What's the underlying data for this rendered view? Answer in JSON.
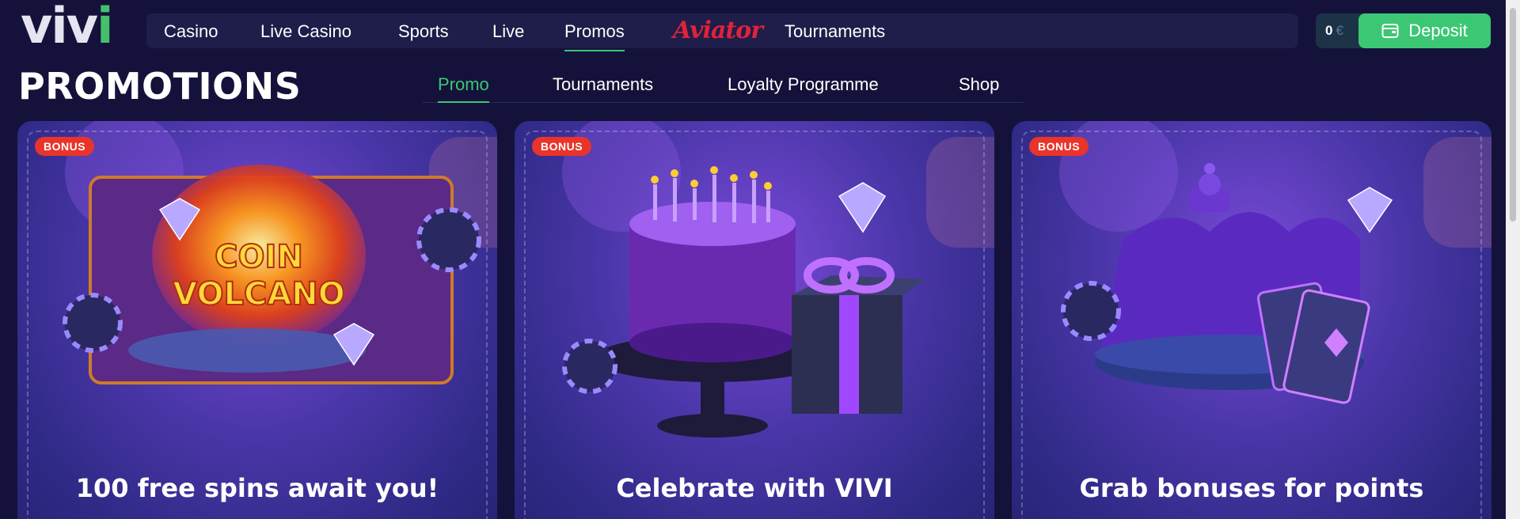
{
  "logo": {
    "left": "viv",
    "accent": "i"
  },
  "nav": {
    "items": [
      "Casino",
      "Live Casino",
      "Sports",
      "Live",
      "Promos"
    ],
    "aviator": "Aviator",
    "tournaments": "Tournaments",
    "active": "Promos"
  },
  "wallet": {
    "balance": "0",
    "currency": "€",
    "deposit_label": "Deposit"
  },
  "page": {
    "title": "PROMOTIONS"
  },
  "subtabs": [
    "Promo",
    "Tournaments",
    "Loyalty Programme",
    "Shop"
  ],
  "cards": [
    {
      "badge": "BONUS",
      "title": "100 free spins await you!",
      "art_text_1": "COIN",
      "art_text_2": "VOLCANO"
    },
    {
      "badge": "BONUS",
      "title": "Celebrate with VIVI"
    },
    {
      "badge": "BONUS",
      "title": "Grab bonuses for points"
    }
  ],
  "colors": {
    "accent": "#3cc774",
    "background": "#14123a",
    "badge": "#e8342a",
    "aviator": "#e0223a"
  },
  "icons": [
    "wallet-icon",
    "diamond-icon",
    "poker-chip-icon",
    "cake-icon",
    "gift-icon",
    "crown-icon",
    "playing-cards-icon"
  ]
}
